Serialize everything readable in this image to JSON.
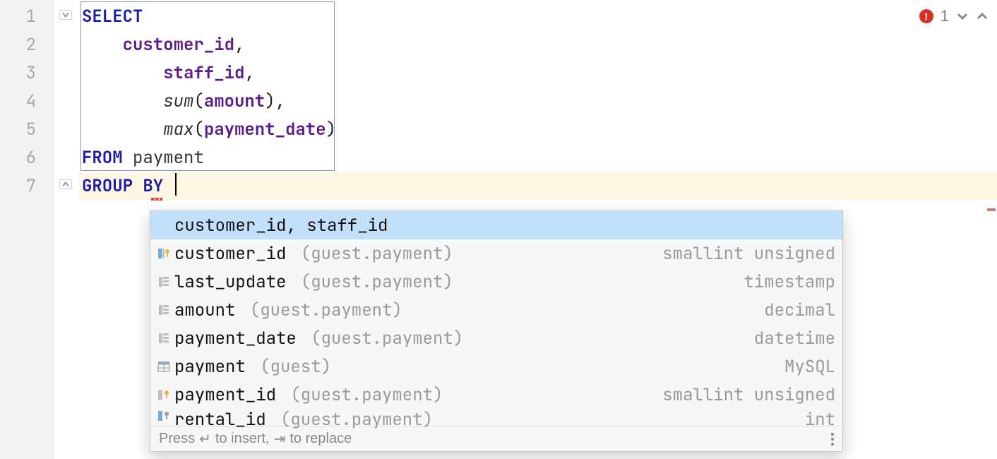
{
  "gutter": {
    "lines": [
      "1",
      "2",
      "3",
      "4",
      "5",
      "6",
      "7"
    ]
  },
  "code": {
    "l1": {
      "kw": "SELECT"
    },
    "l2": {
      "indent": "    ",
      "id": "customer_id",
      "tail": ","
    },
    "l3": {
      "indent": "        ",
      "id": "staff_id",
      "tail": ","
    },
    "l4": {
      "indent": "        ",
      "fn": "sum",
      "open": "(",
      "arg": "amount",
      "close": ")",
      "tail": ","
    },
    "l5": {
      "indent": "        ",
      "fn": "max",
      "open": "(",
      "arg": "payment_date",
      "close": ")"
    },
    "l6": {
      "kw": "FROM",
      "sp": " ",
      "tbl": "payment"
    },
    "l7": {
      "kw": "GROUP BY",
      "sp": " "
    }
  },
  "inspection": {
    "count": "1"
  },
  "completion": {
    "rows": [
      {
        "label": "customer_id, staff_id",
        "context": "",
        "type": "",
        "icon": "none",
        "selected": true
      },
      {
        "label": "customer_id",
        "context": " (guest.payment)",
        "type": "smallint unsigned",
        "icon": "col-key"
      },
      {
        "label": "last_update",
        "context": " (guest.payment)",
        "type": "timestamp",
        "icon": "col"
      },
      {
        "label": "amount",
        "context": " (guest.payment)",
        "type": "decimal",
        "icon": "col"
      },
      {
        "label": "payment_date",
        "context": " (guest.payment)",
        "type": "datetime",
        "icon": "col"
      },
      {
        "label": "payment",
        "context": " (guest)",
        "type": "MySQL",
        "icon": "table"
      },
      {
        "label": "payment_id",
        "context": " (guest.payment)",
        "type": "smallint unsigned",
        "icon": "col-key"
      },
      {
        "label": "rental_id",
        "context": " (guest.payment)",
        "type": "int",
        "icon": "col-key-b",
        "truncated": true
      }
    ],
    "hint_prefix": "Press ",
    "hint_insert": " to insert, ",
    "hint_replace": " to replace"
  }
}
